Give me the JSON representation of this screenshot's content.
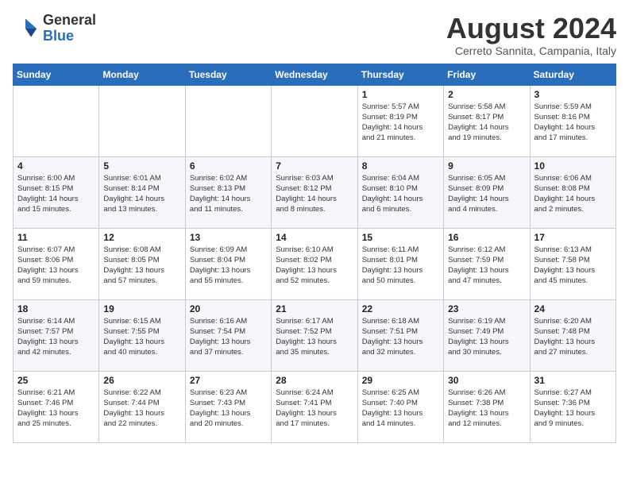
{
  "logo": {
    "general": "General",
    "blue": "Blue"
  },
  "title": {
    "month_year": "August 2024",
    "location": "Cerreto Sannita, Campania, Italy"
  },
  "headers": [
    "Sunday",
    "Monday",
    "Tuesday",
    "Wednesday",
    "Thursday",
    "Friday",
    "Saturday"
  ],
  "weeks": [
    [
      {
        "day": "",
        "info": ""
      },
      {
        "day": "",
        "info": ""
      },
      {
        "day": "",
        "info": ""
      },
      {
        "day": "",
        "info": ""
      },
      {
        "day": "1",
        "info": "Sunrise: 5:57 AM\nSunset: 8:19 PM\nDaylight: 14 hours\nand 21 minutes."
      },
      {
        "day": "2",
        "info": "Sunrise: 5:58 AM\nSunset: 8:17 PM\nDaylight: 14 hours\nand 19 minutes."
      },
      {
        "day": "3",
        "info": "Sunrise: 5:59 AM\nSunset: 8:16 PM\nDaylight: 14 hours\nand 17 minutes."
      }
    ],
    [
      {
        "day": "4",
        "info": "Sunrise: 6:00 AM\nSunset: 8:15 PM\nDaylight: 14 hours\nand 15 minutes."
      },
      {
        "day": "5",
        "info": "Sunrise: 6:01 AM\nSunset: 8:14 PM\nDaylight: 14 hours\nand 13 minutes."
      },
      {
        "day": "6",
        "info": "Sunrise: 6:02 AM\nSunset: 8:13 PM\nDaylight: 14 hours\nand 11 minutes."
      },
      {
        "day": "7",
        "info": "Sunrise: 6:03 AM\nSunset: 8:12 PM\nDaylight: 14 hours\nand 8 minutes."
      },
      {
        "day": "8",
        "info": "Sunrise: 6:04 AM\nSunset: 8:10 PM\nDaylight: 14 hours\nand 6 minutes."
      },
      {
        "day": "9",
        "info": "Sunrise: 6:05 AM\nSunset: 8:09 PM\nDaylight: 14 hours\nand 4 minutes."
      },
      {
        "day": "10",
        "info": "Sunrise: 6:06 AM\nSunset: 8:08 PM\nDaylight: 14 hours\nand 2 minutes."
      }
    ],
    [
      {
        "day": "11",
        "info": "Sunrise: 6:07 AM\nSunset: 8:06 PM\nDaylight: 13 hours\nand 59 minutes."
      },
      {
        "day": "12",
        "info": "Sunrise: 6:08 AM\nSunset: 8:05 PM\nDaylight: 13 hours\nand 57 minutes."
      },
      {
        "day": "13",
        "info": "Sunrise: 6:09 AM\nSunset: 8:04 PM\nDaylight: 13 hours\nand 55 minutes."
      },
      {
        "day": "14",
        "info": "Sunrise: 6:10 AM\nSunset: 8:02 PM\nDaylight: 13 hours\nand 52 minutes."
      },
      {
        "day": "15",
        "info": "Sunrise: 6:11 AM\nSunset: 8:01 PM\nDaylight: 13 hours\nand 50 minutes."
      },
      {
        "day": "16",
        "info": "Sunrise: 6:12 AM\nSunset: 7:59 PM\nDaylight: 13 hours\nand 47 minutes."
      },
      {
        "day": "17",
        "info": "Sunrise: 6:13 AM\nSunset: 7:58 PM\nDaylight: 13 hours\nand 45 minutes."
      }
    ],
    [
      {
        "day": "18",
        "info": "Sunrise: 6:14 AM\nSunset: 7:57 PM\nDaylight: 13 hours\nand 42 minutes."
      },
      {
        "day": "19",
        "info": "Sunrise: 6:15 AM\nSunset: 7:55 PM\nDaylight: 13 hours\nand 40 minutes."
      },
      {
        "day": "20",
        "info": "Sunrise: 6:16 AM\nSunset: 7:54 PM\nDaylight: 13 hours\nand 37 minutes."
      },
      {
        "day": "21",
        "info": "Sunrise: 6:17 AM\nSunset: 7:52 PM\nDaylight: 13 hours\nand 35 minutes."
      },
      {
        "day": "22",
        "info": "Sunrise: 6:18 AM\nSunset: 7:51 PM\nDaylight: 13 hours\nand 32 minutes."
      },
      {
        "day": "23",
        "info": "Sunrise: 6:19 AM\nSunset: 7:49 PM\nDaylight: 13 hours\nand 30 minutes."
      },
      {
        "day": "24",
        "info": "Sunrise: 6:20 AM\nSunset: 7:48 PM\nDaylight: 13 hours\nand 27 minutes."
      }
    ],
    [
      {
        "day": "25",
        "info": "Sunrise: 6:21 AM\nSunset: 7:46 PM\nDaylight: 13 hours\nand 25 minutes."
      },
      {
        "day": "26",
        "info": "Sunrise: 6:22 AM\nSunset: 7:44 PM\nDaylight: 13 hours\nand 22 minutes."
      },
      {
        "day": "27",
        "info": "Sunrise: 6:23 AM\nSunset: 7:43 PM\nDaylight: 13 hours\nand 20 minutes."
      },
      {
        "day": "28",
        "info": "Sunrise: 6:24 AM\nSunset: 7:41 PM\nDaylight: 13 hours\nand 17 minutes."
      },
      {
        "day": "29",
        "info": "Sunrise: 6:25 AM\nSunset: 7:40 PM\nDaylight: 13 hours\nand 14 minutes."
      },
      {
        "day": "30",
        "info": "Sunrise: 6:26 AM\nSunset: 7:38 PM\nDaylight: 13 hours\nand 12 minutes."
      },
      {
        "day": "31",
        "info": "Sunrise: 6:27 AM\nSunset: 7:36 PM\nDaylight: 13 hours\nand 9 minutes."
      }
    ]
  ]
}
